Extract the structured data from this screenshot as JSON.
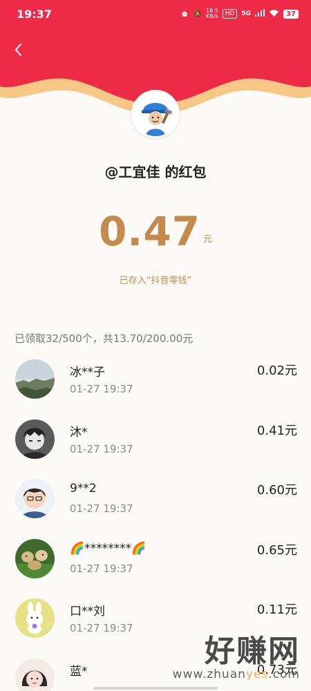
{
  "status_bar": {
    "time": "19:37",
    "net_speed": "18.5",
    "net_unit": "KB/s",
    "hd": "HD",
    "signal": "5G",
    "battery": "37"
  },
  "header": {
    "sender_title": "@工宜佳 的红包",
    "colors": {
      "red": "#ee2b46",
      "gold": "#f7c97d"
    }
  },
  "amount": {
    "value": "0.47",
    "unit": "元",
    "saved_note": "已存入“抖音零钱”"
  },
  "summary": "已领取32/500个，共13.70/200.00元",
  "recipients": [
    {
      "name": "冰**子",
      "time": "01-27 19:37",
      "amount": "0.02元",
      "avatar": "landscape-avatar"
    },
    {
      "name": "沐*",
      "time": "01-27 19:37",
      "amount": "0.41元",
      "avatar": "anime-boy-avatar"
    },
    {
      "name": "9**2",
      "time": "01-27 19:37",
      "amount": "0.60元",
      "avatar": "cartoon-boy-avatar"
    },
    {
      "name": "🌈********🌈",
      "time": "01-27 19:37",
      "amount": "0.65元",
      "avatar": "puppies-avatar"
    },
    {
      "name": "口**刘",
      "time": "01-27 19:37",
      "amount": "0.11元",
      "avatar": "bunny-avatar"
    },
    {
      "name": "蓝*",
      "time": "",
      "amount": "0.73元",
      "avatar": "girl-avatar"
    }
  ],
  "watermark": {
    "big": "好赚网",
    "small_prefix": "www.zhuan",
    "small_highlight": "yes",
    "small_suffix": ".com"
  }
}
